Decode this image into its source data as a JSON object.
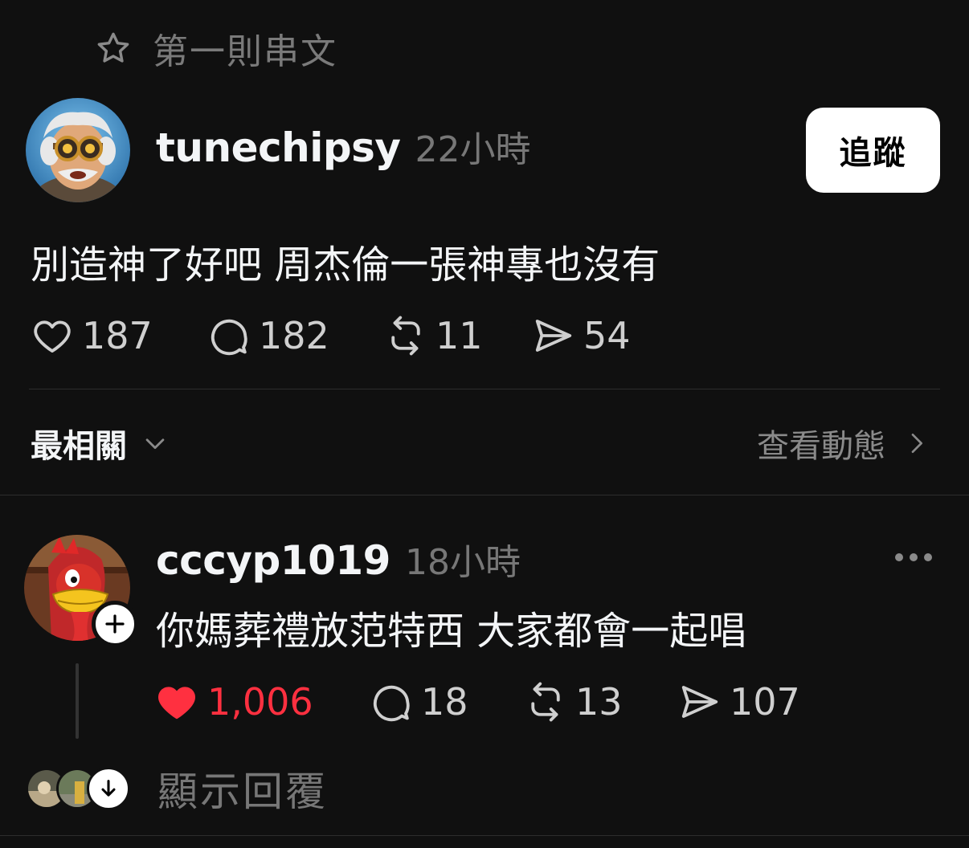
{
  "pinned": {
    "label": "第一則串文",
    "icon": "star-outline-icon"
  },
  "post": {
    "username": "tunechipsy",
    "time": "22小時",
    "follow_label": "追蹤",
    "content": "別造神了好吧 周杰倫一張神專也沒有",
    "stats": {
      "likes": "187",
      "comments": "182",
      "reposts": "11",
      "shares": "54"
    }
  },
  "sort": {
    "label": "最相關",
    "icon": "chevron-down-icon"
  },
  "activity": {
    "label": "查看動態",
    "icon": "chevron-right-icon"
  },
  "reply": {
    "username": "cccyp1019",
    "time": "18小時",
    "content": "你媽葬禮放范特西 大家都會一起唱",
    "liked": true,
    "stats": {
      "likes": "1,006",
      "comments": "18",
      "reposts": "13",
      "shares": "107"
    }
  },
  "show_replies": {
    "label": "顯示回覆"
  },
  "colors": {
    "background": "#101010",
    "like_red": "#ff3040",
    "muted": "#777777"
  }
}
